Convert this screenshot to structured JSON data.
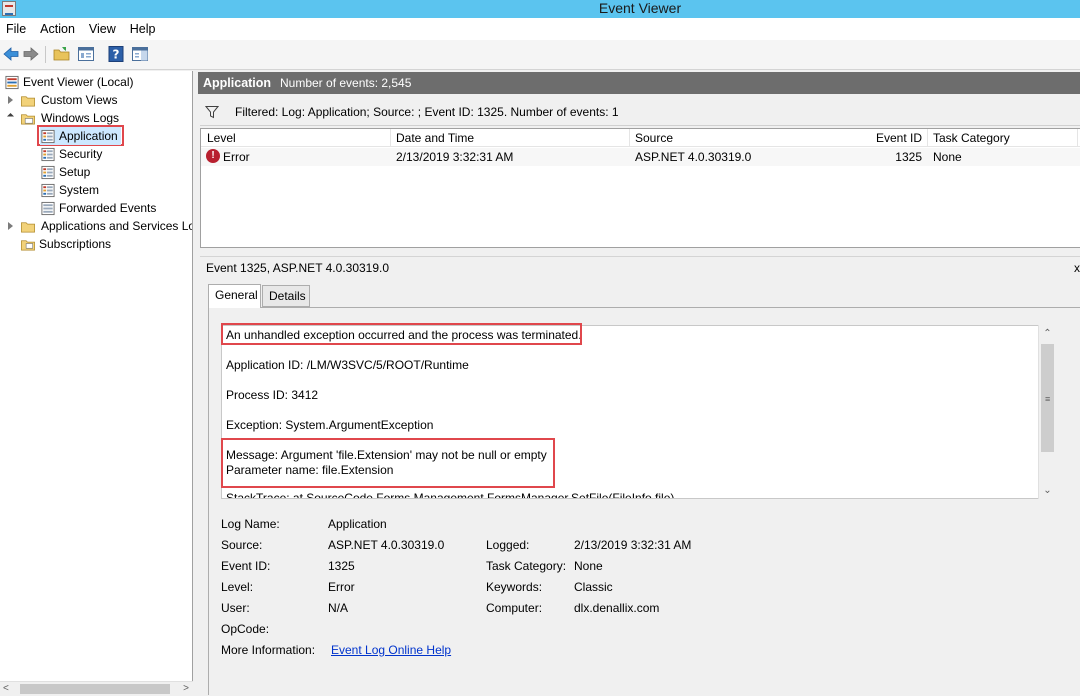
{
  "window": {
    "title": "Event Viewer"
  },
  "menu": [
    "File",
    "Action",
    "View",
    "Help"
  ],
  "tree": {
    "root": "Event Viewer (Local)",
    "custom_views": "Custom Views",
    "windows_logs": "Windows Logs",
    "application": "Application",
    "security": "Security",
    "setup": "Setup",
    "system": "System",
    "forwarded": "Forwarded Events",
    "apps_services": "Applications and Services Lo",
    "subscriptions": "Subscriptions"
  },
  "header": {
    "name": "Application",
    "count": "Number of events: 2,545"
  },
  "filter": {
    "text": "Filtered: Log: Application; Source: ; Event ID: 1325. Number of events: 1"
  },
  "grid": {
    "columns": [
      "Level",
      "Date and Time",
      "Source",
      "Event ID",
      "Task Category"
    ],
    "rows": [
      {
        "level": "Error",
        "date": "2/13/2019 3:32:31 AM",
        "source": "ASP.NET 4.0.30319.0",
        "event_id": "1325",
        "task_category": "None"
      }
    ]
  },
  "detail": {
    "title": "Event 1325, ASP.NET 4.0.30319.0",
    "close": "x",
    "tabs": [
      "General",
      "Details"
    ],
    "lines": [
      "An unhandled exception occurred and the process was terminated.",
      "Application ID: /LM/W3SVC/5/ROOT/Runtime",
      "Process ID: 3412",
      "Exception: System.ArgumentException",
      "Message: Argument 'file.Extension' may not be null or empty",
      "Parameter name: file.Extension",
      "StackTrace:    at SourceCode.Forms.Management.FormsManager.SetFile(FileInfo file)"
    ],
    "props": {
      "log_name_label": "Log Name:",
      "log_name": "Application",
      "source_label": "Source:",
      "source": "ASP.NET 4.0.30319.0",
      "logged_label": "Logged:",
      "logged": "2/13/2019 3:32:31 AM",
      "event_id_label": "Event ID:",
      "event_id": "1325",
      "task_label": "Task Category:",
      "task": "None",
      "level_label": "Level:",
      "level": "Error",
      "keywords_label": "Keywords:",
      "keywords": "Classic",
      "user_label": "User:",
      "user": "N/A",
      "computer_label": "Computer:",
      "computer": "dlx.denallix.com",
      "opcode_label": "OpCode:",
      "more_label": "More Information:",
      "more_link": "Event Log Online Help"
    }
  },
  "colors": {
    "titlebar": "#5bc4ef",
    "header": "#6d6d6d",
    "highlight": "#e0474c",
    "link": "#0033cc",
    "error": "#b8202f"
  }
}
